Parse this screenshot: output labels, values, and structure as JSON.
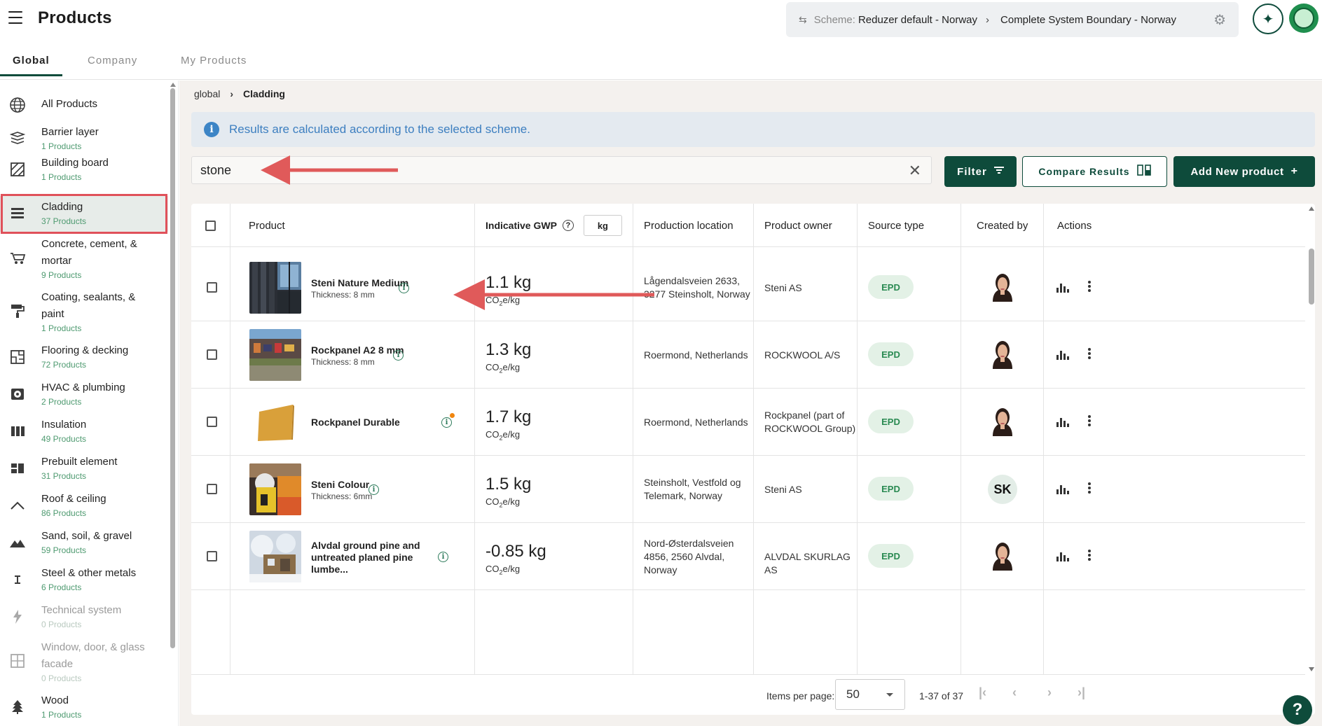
{
  "header": {
    "title": "Products",
    "scheme_label": "Scheme:",
    "scheme_value": "Reduzer default - Norway",
    "boundary_value": "Complete System Boundary - Norway"
  },
  "tabs": [
    {
      "label": "Global",
      "active": true
    },
    {
      "label": "Company",
      "active": false
    },
    {
      "label": "My Products",
      "active": false
    }
  ],
  "sidebar": {
    "items": [
      {
        "name": "All Products",
        "count": "",
        "icon": "globe-icon"
      },
      {
        "name": "Barrier layer",
        "count": "1 Products",
        "icon": "layers-icon"
      },
      {
        "name": "Building board",
        "count": "1 Products",
        "icon": "hatched-board-icon"
      },
      {
        "name": "Cladding",
        "count": "37 Products",
        "icon": "cladding-lines-icon",
        "active": true
      },
      {
        "name": "Concrete, cement, & mortar",
        "count": "9 Products",
        "icon": "wheelbarrow-icon"
      },
      {
        "name": "Coating, sealants, & paint",
        "count": "1 Products",
        "icon": "paint-roller-icon"
      },
      {
        "name": "Flooring & decking",
        "count": "72 Products",
        "icon": "floorplan-icon"
      },
      {
        "name": "HVAC & plumbing",
        "count": "2 Products",
        "icon": "hvac-unit-icon"
      },
      {
        "name": "Insulation",
        "count": "49 Products",
        "icon": "insulation-icon"
      },
      {
        "name": "Prebuilt element",
        "count": "31 Products",
        "icon": "prebuilt-grid-icon"
      },
      {
        "name": "Roof & ceiling",
        "count": "86 Products",
        "icon": "roof-icon"
      },
      {
        "name": "Sand, soil, & gravel",
        "count": "59 Products",
        "icon": "mountain-icon"
      },
      {
        "name": "Steel & other metals",
        "count": "6 Products",
        "icon": "i-beam-icon"
      },
      {
        "name": "Technical system",
        "count": "0 Products",
        "icon": "lightning-icon",
        "disabled": true
      },
      {
        "name": "Window, door, & glass facade",
        "count": "0 Products",
        "icon": "window-icon",
        "disabled": true
      },
      {
        "name": "Wood",
        "count": "1 Products",
        "icon": "tree-icon"
      }
    ]
  },
  "breadcrumb": {
    "root": "global",
    "current": "Cladding"
  },
  "info_banner": {
    "text": "Results are calculated according to the selected scheme."
  },
  "search": {
    "value": "stone"
  },
  "buttons": {
    "filter": "Filter",
    "compare": "Compare Results",
    "add": "Add New product"
  },
  "table": {
    "headers": {
      "product": "Product",
      "gwp": "Indicative GWP",
      "unit": "kg",
      "location": "Production location",
      "owner": "Product owner",
      "source": "Source type",
      "created_by": "Created by",
      "actions": "Actions"
    },
    "gwp_unit": "CO",
    "gwp_unit_sub": "2",
    "gwp_unit_tail": "e/kg",
    "rows": [
      {
        "name": "Steni Nature Medium",
        "thickness": "Thickness: 8 mm",
        "gwp": "1.1 kg",
        "location": "Lågendalsveien 2633, 3277 Steinsholt, Norway",
        "owner": "Steni AS",
        "source": "EPD",
        "creator": "avatar"
      },
      {
        "name": "Rockpanel A2 8 mm",
        "thickness": "Thickness: 8 mm",
        "gwp": "1.3 kg",
        "location": "Roermond, Netherlands",
        "owner": "ROCKWOOL A/S",
        "source": "EPD",
        "creator": "avatar"
      },
      {
        "name": "Rockpanel Durable",
        "thickness": "",
        "gwp": "1.7 kg",
        "location": "Roermond, Netherlands",
        "owner": "Rockpanel (part of ROCKWOOL Group)",
        "source": "EPD",
        "creator": "avatar"
      },
      {
        "name": "Steni Colour",
        "thickness": "Thickness: 6mm",
        "gwp": "1.5 kg",
        "location": "Steinsholt, Vestfold og Telemark, Norway",
        "owner": "Steni AS",
        "source": "EPD",
        "creator": "SK"
      },
      {
        "name": "Alvdal ground pine and untreated planed pine lumbe...",
        "thickness": "",
        "gwp": "-0.85 kg",
        "location": "Nord-Østerdalsveien 4856, 2560 Alvdal, Norway",
        "owner": "ALVDAL SKURLAG AS",
        "source": "EPD",
        "creator": "avatar"
      }
    ]
  },
  "pagination": {
    "items_per_page_label": "Items per page:",
    "items_per_page": "50",
    "range": "1-37 of 37"
  },
  "help": "?",
  "colors": {
    "brand": "#0e4b3b",
    "annotation": "#e0515a",
    "epd_bg": "#e3f1e6",
    "count_text": "#4e9a70"
  }
}
